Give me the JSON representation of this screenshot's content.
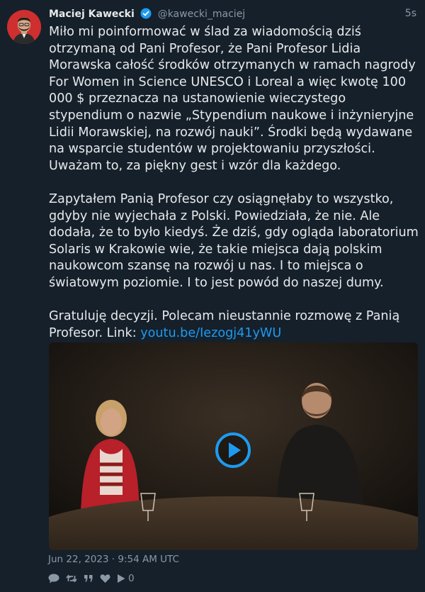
{
  "author": {
    "name": "Maciej Kawecki",
    "handle": "@kawecki_maciej",
    "verified": true
  },
  "timestamp_relative": "5s",
  "tweet": {
    "paragraph1": "Miło mi poinformować w ślad za wiadomością dziś otrzymaną od Pani Profesor, że Pani Profesor Lidia Morawska całość środków otrzymanych w ramach nagrody For Women in Science UNESCO i Loreal a więc kwotę 100 000 $ przeznacza na ustanowienie wieczystego stypendium o nazwie „Stypendium naukowe i inżynieryjne Lidii Morawskiej, na rozwój nauki”. Środki będą wydawane na wsparcie studentów w projektowaniu przyszłości. Uważam to, za piękny gest i wzór dla każdego.",
    "paragraph2": "Zapytałem Panią Profesor czy osiągnęłaby to wszystko, gdyby nie wyjechała z Polski. Powiedziała, że nie. Ale dodała, że to było kiedyś. Że dziś, gdy ogląda laboratorium Solaris w Krakowie wie, że takie miejsca dają polskim naukowcom szansę na rozwój u nas. I to miejsca o światowym poziomie. I to jest powód do naszej dumy.",
    "paragraph3_text": "Gratuluję decyzji. Polecam nieustannie rozmowę z Panią Profesor. Link: ",
    "link_text": "youtu.be/Iezogj41yWU"
  },
  "date_full": "Jun 22, 2023 · 9:54 AM UTC",
  "actions": {
    "views_count": "0"
  },
  "icons": {
    "verified": "verified-badge-icon",
    "play": "play-icon",
    "reply": "reply-icon",
    "retweet": "retweet-icon",
    "quote": "quote-icon",
    "like": "heart-icon",
    "views": "views-play-icon"
  },
  "colors": {
    "background": "#15202b",
    "text": "#e7e9ea",
    "muted": "#8b98a5",
    "accent": "#1d9bf0"
  }
}
